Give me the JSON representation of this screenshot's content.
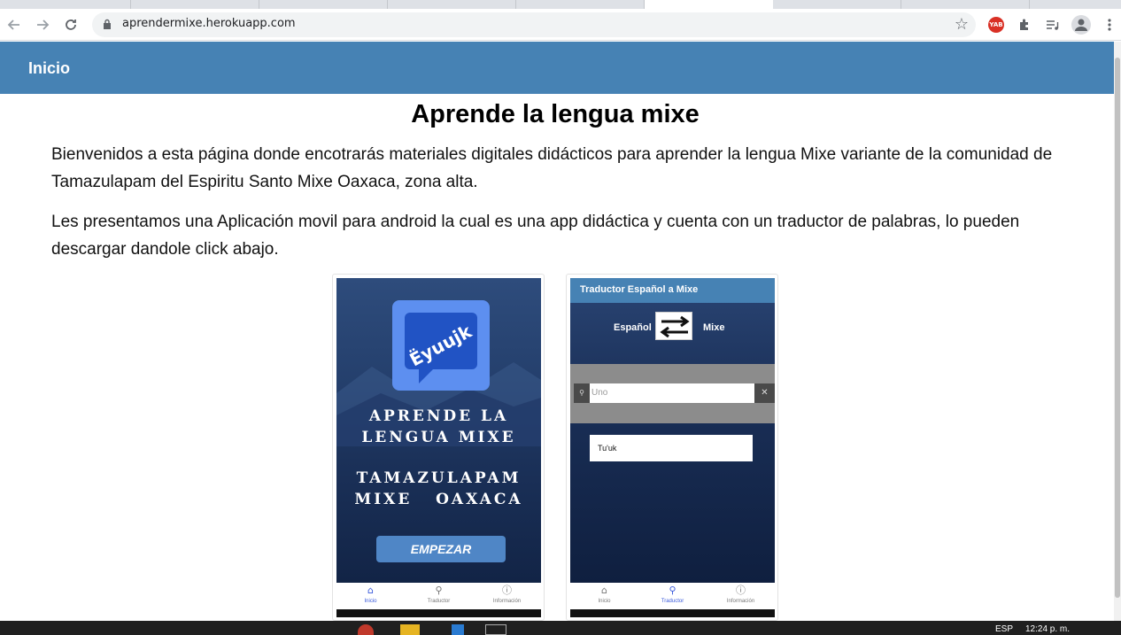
{
  "browser": {
    "url": "aprendermixe.herokuapp.com",
    "extension_badge": "YAB"
  },
  "navbar": {
    "brand": "Inicio"
  },
  "main": {
    "title": "Aprende la lengua mixe",
    "paragraphs": [
      "Bienvenidos a esta página donde encotrarás materiales digitales didácticos para aprender la lengua Mixe variante de la comunidad de Tamazulapam del Espiritu Santo Mixe Oaxaca, zona alta.",
      "Les presentamos una Aplicación movil para android la cual es una app didáctica y cuenta con un traductor de palabras, lo pueden descargar dandole click abajo."
    ]
  },
  "phone1": {
    "logo_text": "Ëyuujk",
    "title_line1": "APRENDE LA",
    "title_line2": "LENGUA MIXE",
    "title_line3": "TAMAZULAPAM",
    "title_line4": "MIXE   OAXACA",
    "button": "EMPEZAR",
    "nav": [
      "Inicio",
      "Traductor",
      "Información"
    ],
    "active_nav": 0
  },
  "phone2": {
    "header": "Traductor Español a Mixe",
    "lang_from": "Español",
    "lang_to": "Mixe",
    "input_value": "Uno",
    "result": "Tu'uk",
    "nav": [
      "Inicio",
      "Traductor",
      "Información"
    ],
    "active_nav": 1
  },
  "taskbar": {
    "lang": "ESP",
    "time": "12:24 p. m."
  },
  "colors": {
    "brand": "#4682b4",
    "app_dark": "#122446"
  }
}
